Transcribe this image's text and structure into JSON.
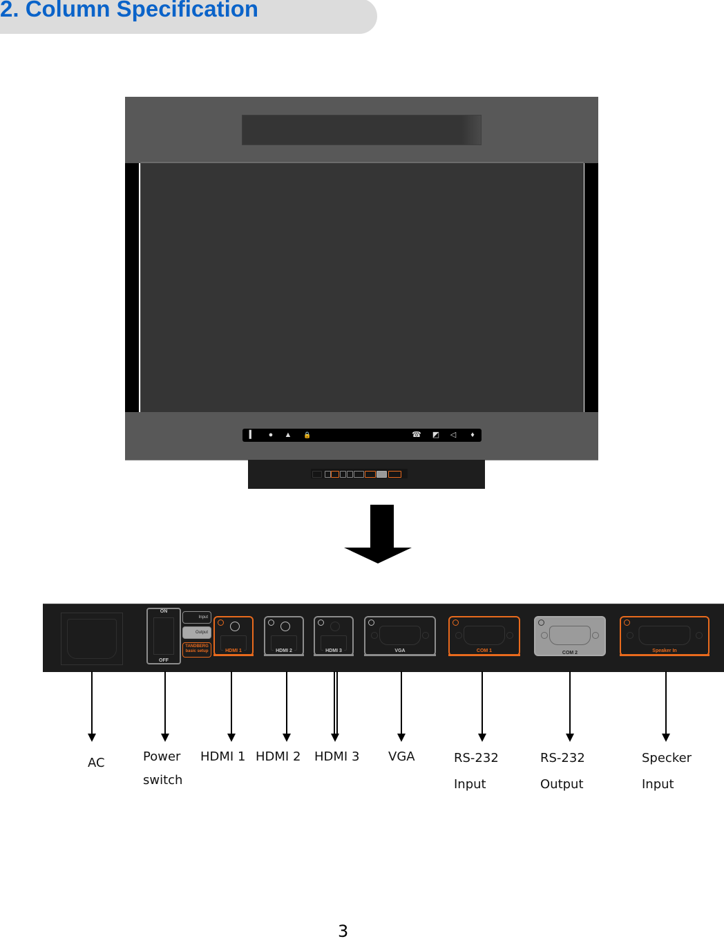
{
  "header": {
    "title": "2. Column Specification",
    "title_color": "#0a63c9"
  },
  "monitor": {
    "control_strip_icons": [
      "power-icon",
      "record-icon",
      "warning-icon",
      "lock-icon",
      "phone-icon",
      "camera-mute-icon",
      "speaker-mute-icon",
      "mic-mute-icon"
    ],
    "control_strip_glyphs": [
      "▍",
      "●",
      "▲",
      "🔒",
      "☎",
      "◩",
      "◁",
      "♦"
    ]
  },
  "panel": {
    "switch_on": "ON",
    "switch_off": "OFF",
    "input_button": "Input",
    "output_button": "Output",
    "setup_button_line1": "TANDBERG",
    "setup_button_line2": "basic setup",
    "ports": {
      "hdmi1": "HDMI 1",
      "hdmi2": "HDMI 2",
      "hdmi3": "HDMI 3",
      "vga": "VGA",
      "com1": "COM 1",
      "com2": "COM 2",
      "speaker": "Speaker In"
    },
    "accent_color": "#e96a1d"
  },
  "callouts": {
    "ac": "AC",
    "power_l1": "Power",
    "power_l2": "switch",
    "hdmi1": "HDMI 1",
    "hdmi2": "HDMI 2",
    "hdmi3": "HDMI 3",
    "vga": "VGA",
    "rs232_in_l1": "RS-232",
    "rs232_in_l2": "Input",
    "rs232_out_l1": "RS-232",
    "rs232_out_l2": "Output",
    "speaker_l1": "Specker",
    "speaker_l2": "Input"
  },
  "footer": {
    "page_number": "3"
  }
}
